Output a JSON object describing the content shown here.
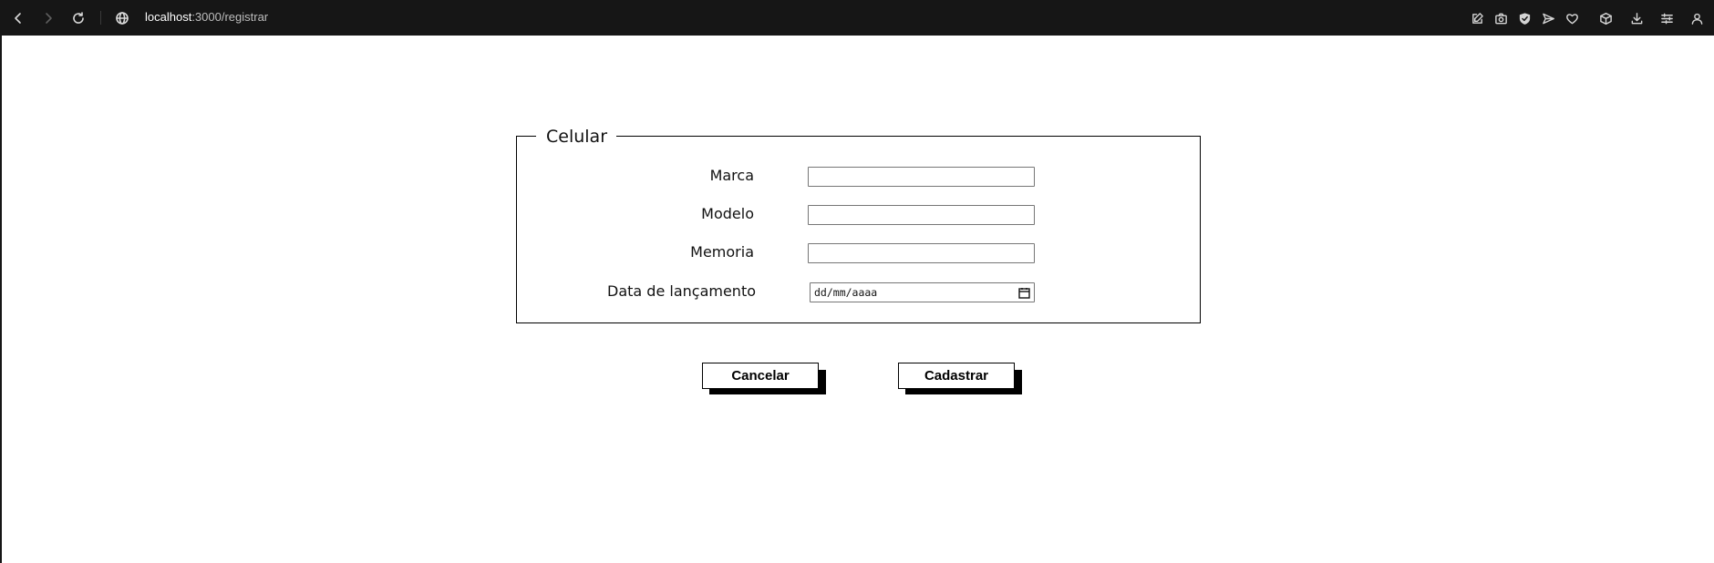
{
  "browser": {
    "url_host": "localhost",
    "url_rest": ":3000/registrar",
    "icons": [
      "back-icon",
      "forward-icon",
      "reload-icon",
      "globe-icon",
      "edit-icon",
      "camera-icon",
      "shield-icon",
      "send-icon",
      "heart-icon",
      "cube-icon",
      "download-icon",
      "sliders-icon",
      "user-icon"
    ]
  },
  "form": {
    "legend": "Celular",
    "fields": [
      {
        "label": "Marca",
        "value": ""
      },
      {
        "label": "Modelo",
        "value": ""
      },
      {
        "label": "Memoria",
        "value": ""
      },
      {
        "label": "Data de lançamento",
        "value": "dd/mm/aaaa"
      }
    ]
  },
  "actions": {
    "cancel_label": "Cancelar",
    "submit_label": "Cadastrar"
  }
}
